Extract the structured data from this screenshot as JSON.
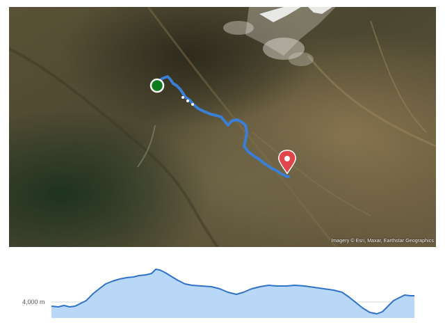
{
  "map": {
    "attribution": "Imagery © Esri, Maxar, Earthstar Geographics",
    "route_color": "#3a7fd5",
    "start_marker_color": "#0f7a1c",
    "end_marker_color": "#e0454a"
  },
  "elevation_profile": {
    "axis_label": "4,000 m",
    "fill_color": "#b9d7f7",
    "line_color": "#2f72c8"
  }
}
